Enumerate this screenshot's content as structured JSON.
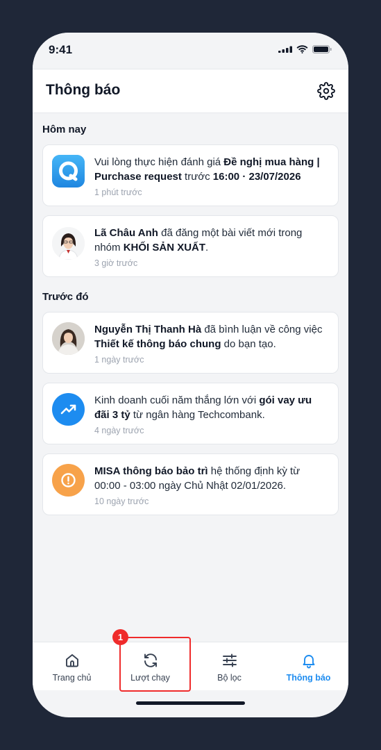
{
  "status_bar": {
    "time": "9:41"
  },
  "header": {
    "title": "Thông báo"
  },
  "sections": {
    "today": "Hôm nay",
    "earlier": "Trước đó"
  },
  "notifications": [
    {
      "icon": "app-logo-q",
      "text_parts": [
        {
          "t": "Vui lòng thực hiện đánh giá ",
          "b": false
        },
        {
          "t": "Đề nghị mua hàng | Purchase request",
          "b": true
        },
        {
          "t": " trước ",
          "b": false
        },
        {
          "t": "16:00 · 23/07/2026",
          "b": true
        }
      ],
      "time": "1 phút trước"
    },
    {
      "icon": "user-avatar",
      "text_parts": [
        {
          "t": "Lã Châu Anh",
          "b": true
        },
        {
          "t": " đã đăng một bài viết mới trong nhóm ",
          "b": false
        },
        {
          "t": "KHỐI SẢN XUẤT",
          "b": true
        },
        {
          "t": ".",
          "b": false
        }
      ],
      "time": "3 giờ trước"
    },
    {
      "icon": "user-avatar",
      "text_parts": [
        {
          "t": "Nguyễn Thị Thanh Hà",
          "b": true
        },
        {
          "t": " đã bình luận về công việc ",
          "b": false
        },
        {
          "t": "Thiết kế thông báo chung",
          "b": true
        },
        {
          "t": " do bạn tạo.",
          "b": false
        }
      ],
      "time": "1 ngày trước"
    },
    {
      "icon": "trending-up-icon",
      "text_parts": [
        {
          "t": "Kinh doanh cuối năm thắng lớn với ",
          "b": false
        },
        {
          "t": "gói vay ưu đãi 3 tỷ",
          "b": true
        },
        {
          "t": " từ ngân hàng Techcombank.",
          "b": false
        }
      ],
      "time": "4 ngày trước"
    },
    {
      "icon": "alert-circle-icon",
      "text_parts": [
        {
          "t": "MISA thông báo bảo trì",
          "b": true
        },
        {
          "t": " hệ thống định kỳ từ 00:00 - 03:00 ngày Chủ Nhật 02/01/2026.",
          "b": false
        }
      ],
      "time": "10 ngày trước"
    }
  ],
  "tabs": [
    {
      "label": "Trang chủ",
      "icon": "home-icon",
      "active": false
    },
    {
      "label": "Lượt chạy",
      "icon": "refresh-icon",
      "active": false
    },
    {
      "label": "Bộ lọc",
      "icon": "sliders-icon",
      "active": false
    },
    {
      "label": "Thông báo",
      "icon": "bell-icon",
      "active": true
    }
  ],
  "highlight": {
    "badge": "1",
    "color": "#ef2b2b"
  },
  "colors": {
    "accent": "#1d8cf0",
    "background": "#1f2738",
    "warning": "#f7a24a"
  }
}
